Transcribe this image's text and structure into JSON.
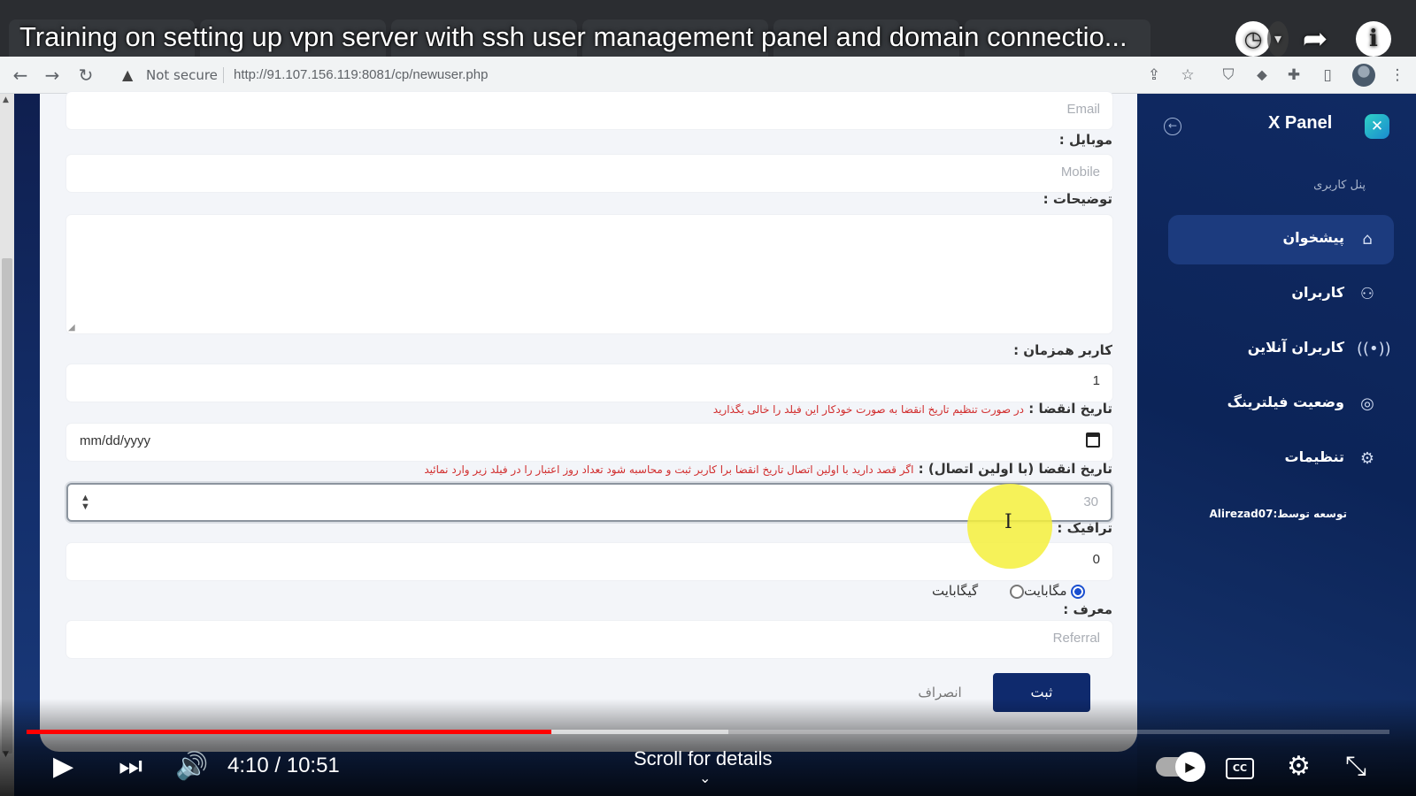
{
  "video": {
    "title": "Training on setting up vpn server with ssh user management panel and domain connectio...",
    "time_display": "4:10 / 10:51",
    "progress": 0.385,
    "buffered": 0.515,
    "scroll_hint": "Scroll for details"
  },
  "browser": {
    "security_label": "Not secure",
    "url": "http://91.107.156.119:8081/cp/newuser.php"
  },
  "form": {
    "email_placeholder": "Email",
    "mobile_label": "موبایل :",
    "mobile_placeholder": "Mobile",
    "description_label": "توضیحات :",
    "concurrent_label": "کاربر همزمان :",
    "concurrent_value": "1",
    "expiry_label": "تاریخ انقضا :",
    "expiry_hint": "در صورت تنظیم تاریخ انقضا به صورت خودکار این فیلد را خالی بگذارید",
    "date_placeholder": "mm/dd/yyyy",
    "expiry_first_label": "تاریخ انقضا (با اولین اتصال) :",
    "expiry_first_hint": "اگر قصد دارید با اولین اتصال تاریخ انقضا برا کاربر ثبت و محاسبه شود تعداد روز اعتبار را در فیلد زیر وارد نمائید",
    "days_placeholder": "30",
    "traffic_label": "ترافیک :",
    "traffic_value": "0",
    "unit_megabyte": "مگابایت",
    "unit_gigabyte": "گیگابایت",
    "unit_selected": "مگابایت",
    "referral_label": "معرف :",
    "referral_placeholder": "Referral",
    "submit_label": "ثبت",
    "cancel_label": "انصراف"
  },
  "sidebar": {
    "brand": "X Panel",
    "brand_logo_glyph": "✕",
    "section_label": "پنل کاربری",
    "items": [
      {
        "label": "پیشخوان",
        "icon": "home-icon",
        "active": true
      },
      {
        "label": "کاربران",
        "icon": "users-icon",
        "active": false
      },
      {
        "label": "کاربران آنلاین",
        "icon": "broadcast-icon",
        "active": false
      },
      {
        "label": "وضعیت فیلترینگ",
        "icon": "target-icon",
        "active": false
      },
      {
        "label": "تنظیمات",
        "icon": "gear-icon",
        "active": false
      }
    ],
    "credit": "توسعه توسط:Alirezad07"
  },
  "colors": {
    "sidebar_bg": "#0c2458",
    "primary_button": "#0f2a6d",
    "hint_red": "#d12d2d",
    "progress_red": "#ff0000",
    "highlight_yellow": "#f5f03c"
  }
}
